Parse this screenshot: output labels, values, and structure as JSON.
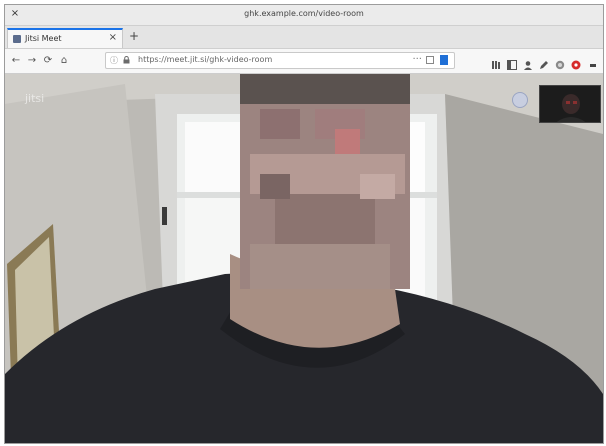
{
  "window": {
    "title": "ghk.example.com/video-room"
  },
  "tabs": [
    {
      "label": "Jitsi Meet"
    }
  ],
  "navbar": {
    "url": "https://meet.jit.si/ghk-video-room"
  },
  "call": {
    "watermark": "jitsi"
  },
  "icons": {
    "close": "close-icon",
    "back": "back-arrow-icon",
    "forward": "forward-arrow-icon",
    "reload": "reload-icon",
    "home": "home-icon",
    "info": "info-icon",
    "lock": "lock-icon",
    "page_actions": "more-horizontal-icon",
    "pocket": "pocket-icon",
    "bookmark": "bookmark-star-icon"
  },
  "colors": {
    "tab_accent": "#1a73e8",
    "bookmark": "#1f6fd6",
    "record_badge": "#d62a2a"
  }
}
